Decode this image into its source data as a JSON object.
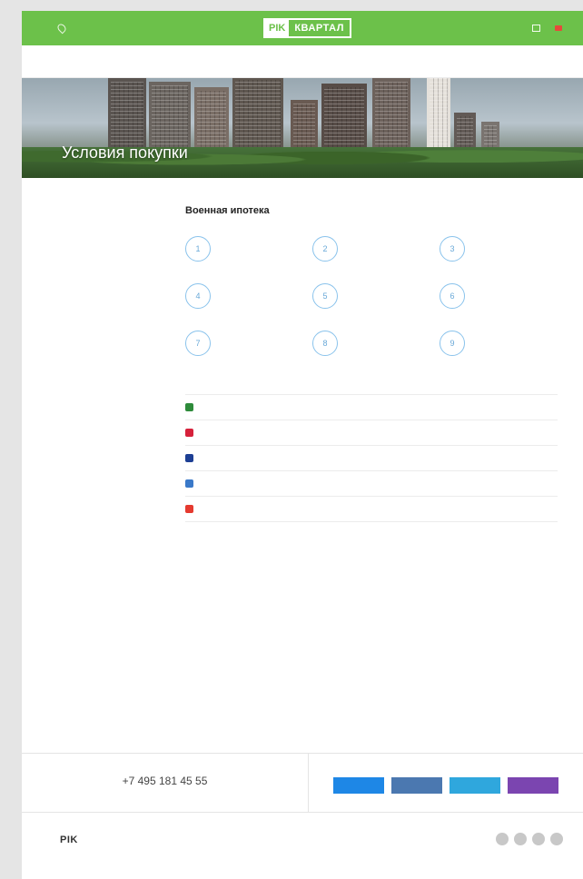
{
  "header": {
    "location": "",
    "logo_left": "PIK",
    "logo_right": "КВАРТАЛ",
    "phone": "",
    "cabinet": "",
    "lang": ""
  },
  "nav": [
    {
      "label": ""
    },
    {
      "label": ""
    },
    {
      "label": "",
      "active": true
    },
    {
      "label": ""
    },
    {
      "label": ""
    },
    {
      "label": ""
    },
    {
      "label": ""
    },
    {
      "label": ""
    }
  ],
  "hero": {
    "title": "Условия покупки"
  },
  "sidebar": {
    "items": [
      {
        "label": ""
      },
      {
        "label": "",
        "active": true
      },
      {
        "label": ""
      }
    ]
  },
  "main": {
    "title": "Военная ипотека",
    "steps": [
      {
        "num": "1",
        "text": ""
      },
      {
        "num": "2",
        "text": ""
      },
      {
        "num": "3",
        "text": ""
      },
      {
        "num": "4",
        "text": ""
      },
      {
        "num": "5",
        "text": ""
      },
      {
        "num": "6",
        "text": ""
      },
      {
        "num": "7",
        "text": ""
      },
      {
        "num": "8",
        "text": ""
      },
      {
        "num": "9",
        "text": ""
      }
    ],
    "description": "",
    "table": {
      "headers": [
        "",
        "",
        "",
        ""
      ],
      "rows": [
        {
          "bank": "",
          "color": "#2e8b3a",
          "c1": "",
          "c2": "",
          "c3": ""
        },
        {
          "bank": "",
          "color": "#d6213b",
          "c1": "",
          "c2": "",
          "c3": ""
        },
        {
          "bank": "",
          "color": "#1d3f94",
          "c1": "",
          "c2": "",
          "c3": ""
        },
        {
          "bank": "",
          "color": "#3a79c9",
          "c1": "",
          "c2": "",
          "c3": ""
        },
        {
          "bank": "",
          "color": "#e53a2f",
          "c1": "",
          "c2": "",
          "c3": ""
        }
      ]
    }
  },
  "footer": {
    "phone": "+7 495 181 45 55",
    "phone_sub": "",
    "share_caption": "",
    "shares": [
      {
        "label": "",
        "color": "#1e87e6"
      },
      {
        "label": "",
        "color": "#4b78b0"
      },
      {
        "label": "",
        "color": "#2fa7dd"
      },
      {
        "label": "",
        "color": "#7b45b0"
      }
    ],
    "logo": "PIK",
    "col1": [
      "",
      "",
      "",
      ""
    ],
    "col2": [
      "",
      "",
      ""
    ],
    "socials": [
      "",
      "",
      "",
      ""
    ],
    "copyright": "",
    "credit": ""
  },
  "colors": {
    "brand_green": "#6cc14a",
    "accent_blue": "#8ac3ec"
  }
}
